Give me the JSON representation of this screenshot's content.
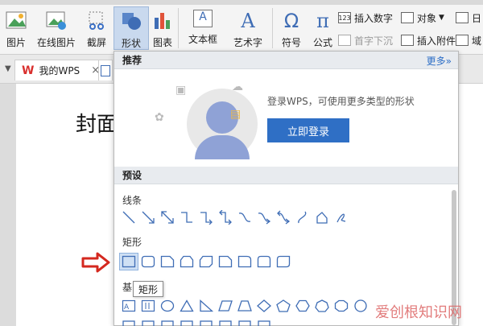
{
  "ribbon": {
    "buttons": [
      {
        "label": "图片"
      },
      {
        "label": "在线图片"
      },
      {
        "label": "截屏"
      },
      {
        "label": "形状"
      },
      {
        "label": "图表"
      },
      {
        "label": "文本框"
      },
      {
        "label": "艺术字"
      },
      {
        "label": "符号"
      },
      {
        "label": "公式"
      }
    ],
    "symbol_glyph": "Ω",
    "formula_glyph": "π",
    "textbox_glyph": "A",
    "wordart_glyph": "A",
    "small_buttons": [
      {
        "label": "插入数字",
        "icon_text": "123"
      },
      {
        "label": "对象"
      },
      {
        "label": "日"
      },
      {
        "label": "首字下沉"
      },
      {
        "label": "插入附件"
      },
      {
        "label": "域"
      }
    ]
  },
  "tabs": {
    "doc_tab_label": "我的WPS",
    "wps_logo": "W",
    "close_glyph": "×"
  },
  "document": {
    "title": "封面"
  },
  "shapes_panel": {
    "recommend_header": "推荐",
    "more_link": "更多»",
    "login_message": "登录WPS，可使用更多类型的形状",
    "login_button": "立即登录",
    "preset_header": "预设",
    "categories": {
      "lines": "线条",
      "rectangles": "矩形",
      "basic": "基"
    }
  },
  "tooltip": "矩形",
  "watermark": "爱创根知识网",
  "colors": {
    "accent": "#2f6fc5",
    "highlight": "#cfe0f4",
    "red_arrow": "#d4281f"
  }
}
